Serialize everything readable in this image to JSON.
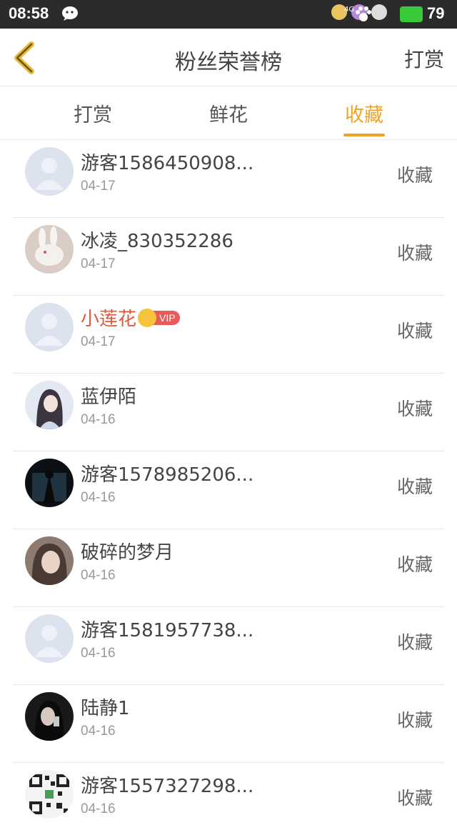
{
  "status_bar": {
    "time": "08:58",
    "network": "4G",
    "battery": "79"
  },
  "header": {
    "back_icon": "chevron-left-icon",
    "title": "粉丝荣誉榜",
    "reward_button": "打赏"
  },
  "tabs": [
    {
      "label": "打赏",
      "active": false
    },
    {
      "label": "鲜花",
      "active": false
    },
    {
      "label": "收藏",
      "active": true
    }
  ],
  "colors": {
    "accent": "#f0a324",
    "vip_name": "#e05a3a",
    "vip_badge": "#e85b5b"
  },
  "list": [
    {
      "name": "游客1586450908...",
      "date": "04-17",
      "action": "收藏",
      "avatar": "default-avatar",
      "vip": false
    },
    {
      "name": "冰凌_830352286",
      "date": "04-17",
      "action": "收藏",
      "avatar": "rabbit-photo",
      "vip": false
    },
    {
      "name": "小莲花",
      "date": "04-17",
      "action": "收藏",
      "avatar": "default-avatar",
      "vip": true,
      "vip_label": "VIP"
    },
    {
      "name": "蓝伊陌",
      "date": "04-16",
      "action": "收藏",
      "avatar": "girl-photo",
      "vip": false
    },
    {
      "name": "游客1578985206...",
      "date": "04-16",
      "action": "收藏",
      "avatar": "dark-figure-photo",
      "vip": false
    },
    {
      "name": "破碎的梦月",
      "date": "04-16",
      "action": "收藏",
      "avatar": "girl-portrait-photo",
      "vip": false
    },
    {
      "name": "游客1581957738...",
      "date": "04-16",
      "action": "收藏",
      "avatar": "default-avatar",
      "vip": false
    },
    {
      "name": "陆静1",
      "date": "04-16",
      "action": "收藏",
      "avatar": "dark-portrait-photo",
      "vip": false
    },
    {
      "name": "游客1557327298...",
      "date": "04-16",
      "action": "收藏",
      "avatar": "qr-code-image",
      "vip": false
    }
  ]
}
